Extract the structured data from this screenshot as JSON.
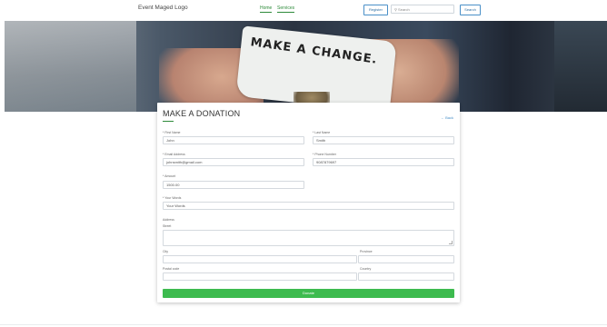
{
  "nav": {
    "logo": "Event Maged Logo",
    "home": "Home",
    "services": "Services",
    "register": "Register",
    "search_placeholder": "Search",
    "search_button": "Search"
  },
  "hero": {
    "sign_text": "MAKE A CHANGE."
  },
  "form": {
    "title": "MAKE A DONATION",
    "back": "← Back",
    "first_name": {
      "label": "* First Name",
      "value": "John"
    },
    "last_name": {
      "label": "* Last Name",
      "value": "Smith"
    },
    "email": {
      "label": "* Email Address",
      "value": "johnsmith@gmail.com"
    },
    "phone": {
      "label": "* Phone Number",
      "value": "9087879697"
    },
    "amount": {
      "label": "* Amount",
      "value": "1500.00"
    },
    "words": {
      "label": "* Your Words",
      "value": "Your Words"
    },
    "address": {
      "label": "Address"
    },
    "street": {
      "label": "Street"
    },
    "city": {
      "label": "City"
    },
    "province": {
      "label": "Province"
    },
    "postal": {
      "label": "Postal code"
    },
    "country": {
      "label": "Country"
    },
    "donate": "Donate"
  }
}
